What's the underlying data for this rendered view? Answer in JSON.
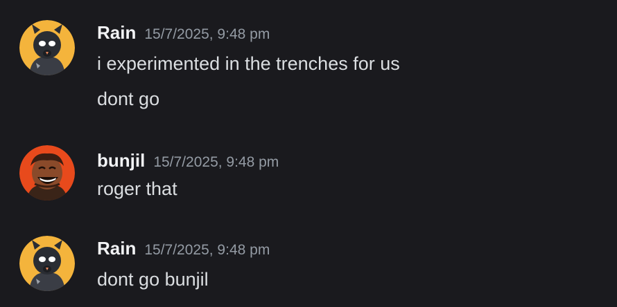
{
  "messages": [
    {
      "username": "Rain",
      "timestamp": "15/7/2025, 9:48 pm",
      "avatar_icon": "black-rat-avatar-icon",
      "avatar_bg": "#f4b43c",
      "lines": [
        "i experimented in the trenches for us",
        "dont go"
      ]
    },
    {
      "username": "bunjil",
      "timestamp": "15/7/2025, 9:48 pm",
      "avatar_icon": "laughing-man-avatar-icon",
      "avatar_bg": "#e84a1c",
      "lines": [
        "roger that"
      ]
    },
    {
      "username": "Rain",
      "timestamp": "15/7/2025, 9:48 pm",
      "avatar_icon": "black-rat-avatar-icon",
      "avatar_bg": "#f4b43c",
      "lines": [
        "dont go bunjil"
      ]
    }
  ],
  "colors": {
    "background": "#1a1a1e",
    "username": "#f2f3f5",
    "timestamp": "#949ba4",
    "message_text": "#dbdee1"
  }
}
